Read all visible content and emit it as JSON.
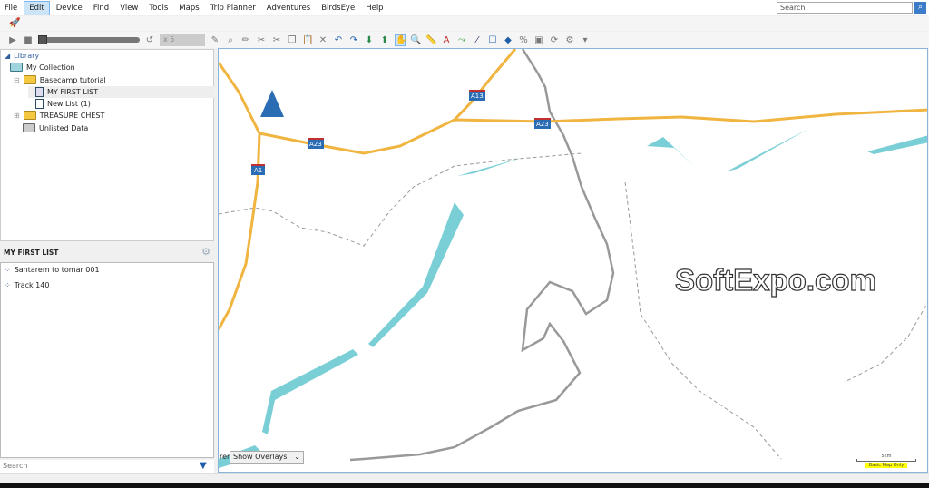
{
  "menu": [
    "File",
    "Edit",
    "Device",
    "Find",
    "View",
    "Tools",
    "Maps",
    "Trip Planner",
    "Adventures",
    "BirdsEye",
    "Help"
  ],
  "search": {
    "placeholder": "Search"
  },
  "toolbar": {
    "speed": "x 5"
  },
  "library": {
    "title": "Library",
    "items": [
      "My Collection",
      "Basecamp tutorial",
      "MY FIRST LIST",
      "New List (1)",
      "TREASURE CHEST",
      "Unlisted Data"
    ]
  },
  "list": {
    "title": "MY FIRST LIST",
    "items": [
      "Santarem to tomar 001",
      "Track 140"
    ]
  },
  "list_search": {
    "placeholder": "Search"
  },
  "map": {
    "overlay_select": "Show Overlays",
    "overlay_prefix": "rer",
    "road_labels": [
      "A13",
      "A23",
      "A23",
      "A1"
    ],
    "scale": "5km",
    "map_mode": "Basic Map Only",
    "watermark": "SoftExpo.com",
    "colors": {
      "road": "#f0b440",
      "water": "#7acfd6",
      "border": "#999999",
      "shield": "#2a6db5"
    }
  }
}
